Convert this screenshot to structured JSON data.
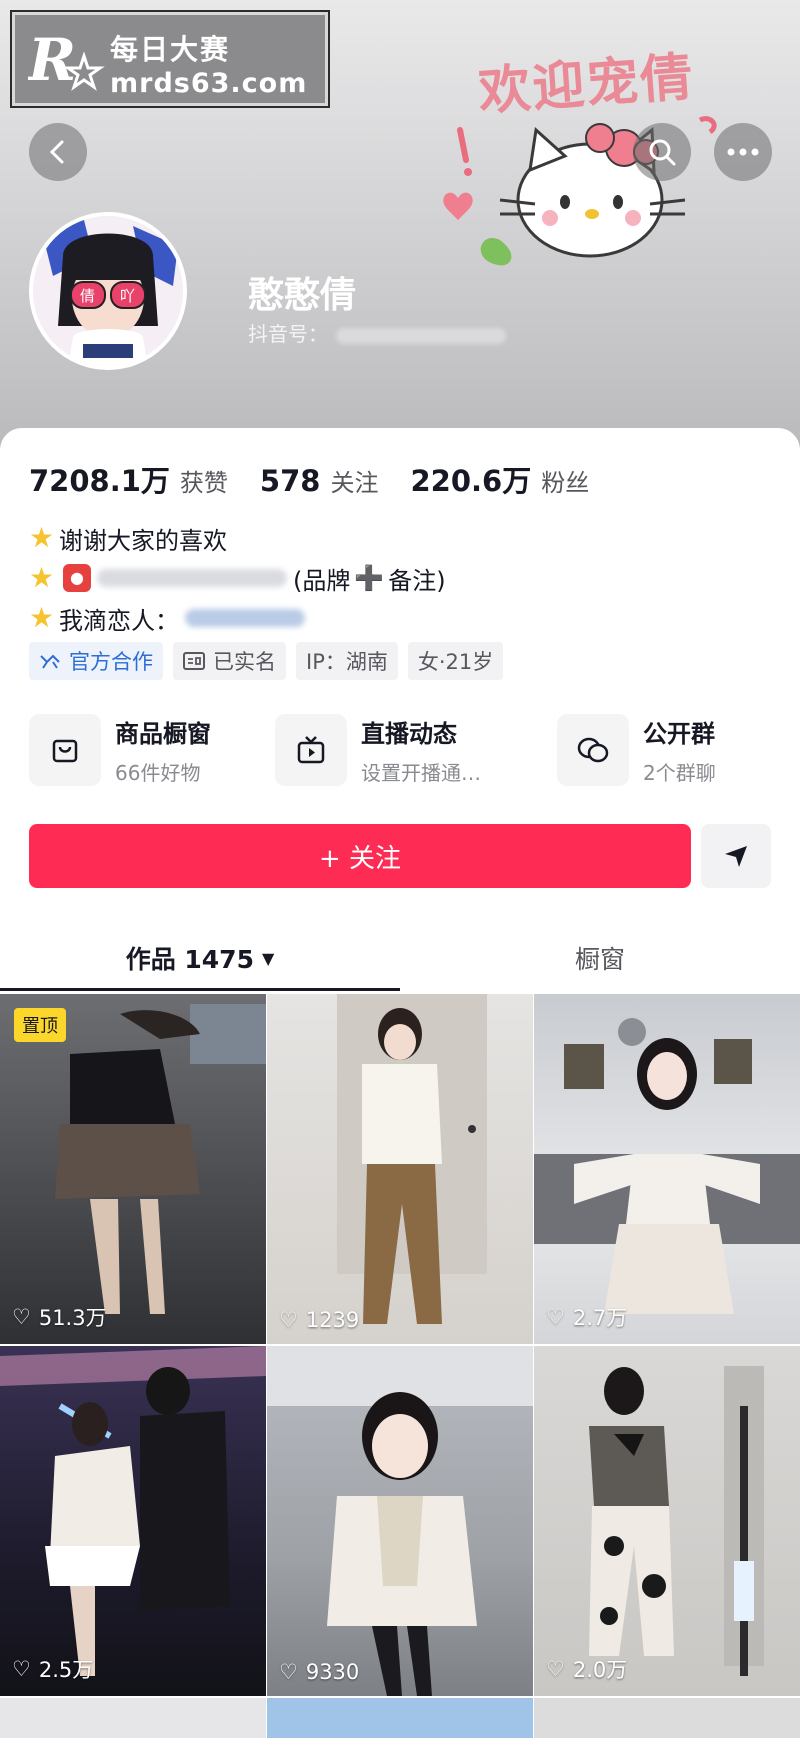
{
  "watermark": {
    "line1": "每日大赛",
    "line2": "mrds63.com"
  },
  "banner": {
    "deco_text": "欢迎宠倩"
  },
  "profile": {
    "nickname": "憨憨倩",
    "douyin_id_label": "抖音号：",
    "avatar_badge_left": "倩",
    "avatar_badge_right": "吖"
  },
  "stats": [
    {
      "value": "7208.1万",
      "label": "获赞"
    },
    {
      "value": "578",
      "label": "关注"
    },
    {
      "value": "220.6万",
      "label": "粉丝"
    }
  ],
  "bio": {
    "line1": "谢谢大家的喜欢",
    "line2_suffix": "(品牌",
    "line2_plus": "➕",
    "line2_end": "备注)",
    "line3": "我滴恋人："
  },
  "tags": [
    "官方合作",
    "已实名",
    "IP：湖南",
    "女·21岁"
  ],
  "features": [
    {
      "title": "商品橱窗",
      "subtitle": "66件好物",
      "icon": "bag-icon"
    },
    {
      "title": "直播动态",
      "subtitle": "设置开播通…",
      "icon": "tv-icon"
    },
    {
      "title": "公开群",
      "subtitle": "2个群聊",
      "icon": "chat-icon"
    }
  ],
  "follow_label": "+ 关注",
  "tabs": {
    "works": "作品 1475",
    "showcase": "橱窗"
  },
  "grid": {
    "pinned_label": "置顶",
    "items": [
      {
        "likes": "51.3万"
      },
      {
        "likes": "1239"
      },
      {
        "likes": "2.7万"
      },
      {
        "likes": "2.5万"
      },
      {
        "likes": "9330"
      },
      {
        "likes": "2.0万"
      }
    ]
  },
  "colors": {
    "accent": "#fe2c55",
    "pinned": "#fbd72b",
    "official": "#2d6ed6"
  }
}
